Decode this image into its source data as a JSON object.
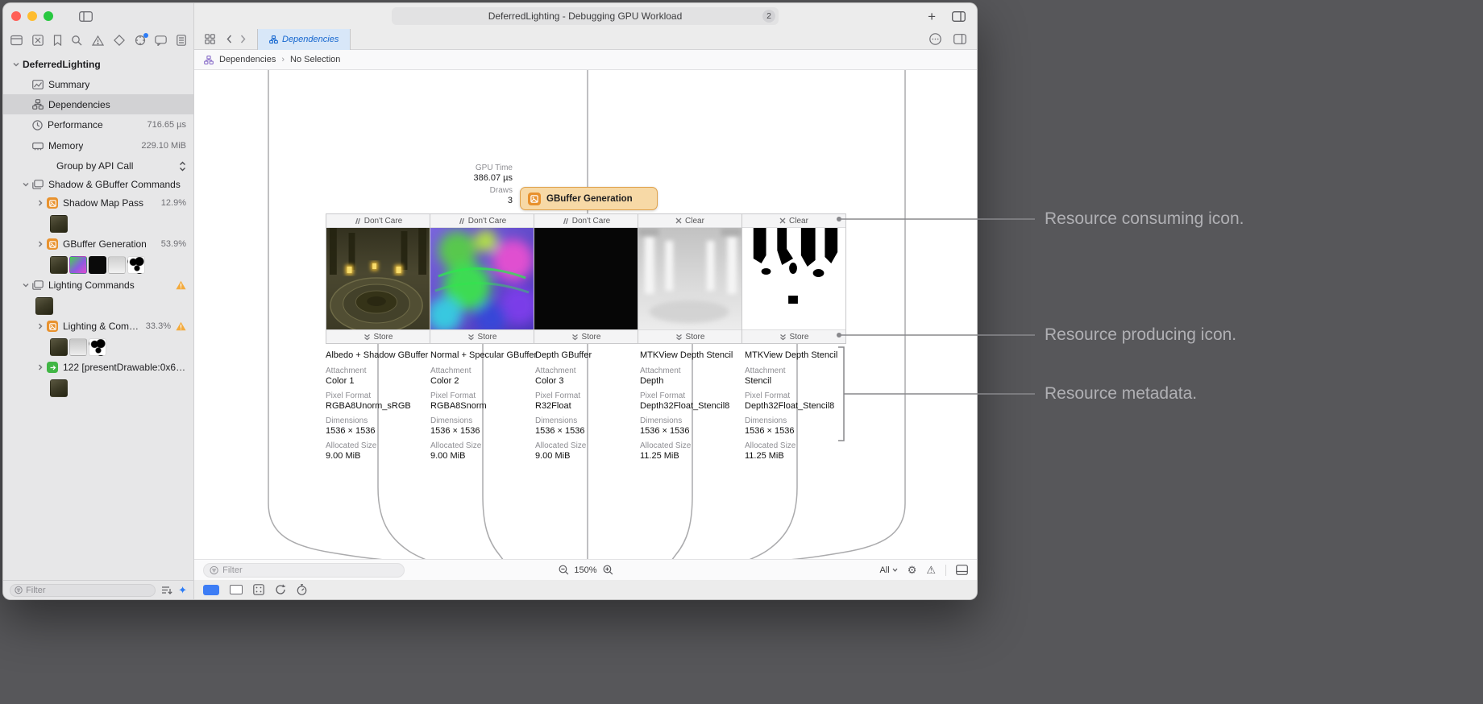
{
  "window": {
    "title": "DeferredLighting - Debugging GPU Workload",
    "badge": "2"
  },
  "icons": {
    "plus": "+",
    "gear": "⚙",
    "warning": "⚠",
    "sparkle": "✦"
  },
  "sidebar": {
    "root": "DeferredLighting",
    "items": {
      "summary": "Summary",
      "dependencies": "Dependencies",
      "performance": "Performance",
      "performance_value": "716.65 µs",
      "memory": "Memory",
      "memory_value": "229.10 MiB",
      "group_by": "Group by API Call",
      "shadow_group": "Shadow & GBuffer Commands",
      "shadow_map_pass": "Shadow Map Pass",
      "shadow_map_value": "12.9%",
      "gbuffer": "GBuffer Generation",
      "gbuffer_value": "53.9%",
      "lighting_group": "Lighting Commands",
      "lighting_pass": "Lighting & Compo…",
      "lighting_value": "33.3%",
      "present_call": "122 [presentDrawable:0x60…"
    },
    "filter_placeholder": "Filter"
  },
  "tabbar": {
    "tab": "Dependencies"
  },
  "jumpbar": {
    "crumb1": "Dependencies",
    "separator": "›",
    "crumb2": "No Selection"
  },
  "canvas": {
    "stats": {
      "gpu_time_label": "GPU Time",
      "gpu_time": "386.07 µs",
      "draws_label": "Draws",
      "draws": "3"
    },
    "node": "GBuffer Generation",
    "field_labels": {
      "attachment": "Attachment",
      "pixel_format": "Pixel Format",
      "dimensions": "Dimensions",
      "allocated_size": "Allocated Size"
    },
    "cards": [
      {
        "load": "Don't Care",
        "store": "Store",
        "title": "Albedo + Shadow GBuffer",
        "attachment": "Color 1",
        "pixel_format": "RGBA8Unorm_sRGB",
        "dimensions": "1536 × 1536",
        "size": "9.00 MiB"
      },
      {
        "load": "Don't Care",
        "store": "Store",
        "title": "Normal + Specular GBuffer",
        "attachment": "Color 2",
        "pixel_format": "RGBA8Snorm",
        "dimensions": "1536 × 1536",
        "size": "9.00 MiB"
      },
      {
        "load": "Don't Care",
        "store": "Store",
        "title": "Depth GBuffer",
        "attachment": "Color 3",
        "pixel_format": "R32Float",
        "dimensions": "1536 × 1536",
        "size": "9.00 MiB"
      },
      {
        "load": "Clear",
        "store": "Store",
        "title": "MTKView Depth Stencil",
        "attachment": "Depth",
        "pixel_format": "Depth32Float_Stencil8",
        "dimensions": "1536 × 1536",
        "size": "11.25 MiB"
      },
      {
        "load": "Clear",
        "store": "Store",
        "title": "MTKView Depth Stencil",
        "attachment": "Stencil",
        "pixel_format": "Depth32Float_Stencil8",
        "dimensions": "1536 × 1536",
        "size": "11.25 MiB"
      }
    ]
  },
  "zoombar": {
    "filter_placeholder": "Filter",
    "zoom": "150%",
    "scope": "All"
  },
  "annotations": {
    "consuming": "Resource consuming icon.",
    "producing": "Resource producing icon.",
    "metadata": "Resource metadata."
  },
  "colors": {
    "accent_blue": "#1667CF",
    "node_fill": "#F7D9A6",
    "node_border": "#DFA14B",
    "pass_icon_orange": "#E8922E",
    "present_icon_green": "#41B645",
    "warning_yellow": "#F3AB3E"
  }
}
